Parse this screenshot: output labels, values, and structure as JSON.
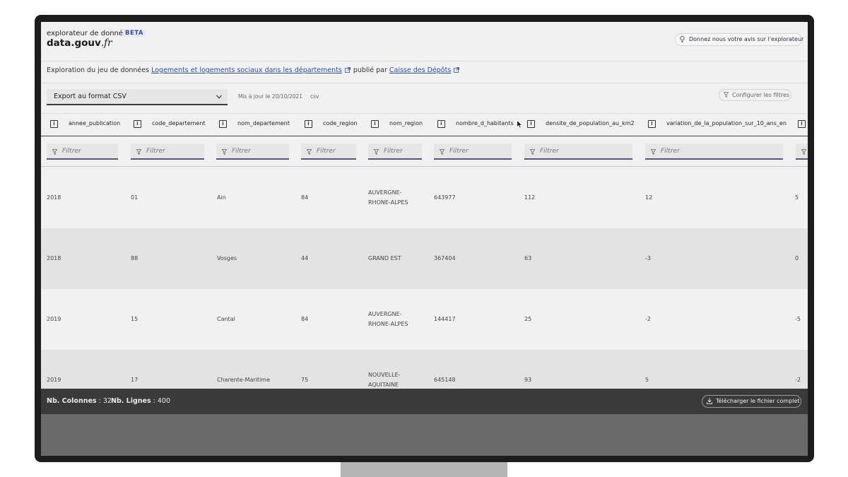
{
  "header": {
    "app_title": "explorateur de données",
    "beta_badge": "BETA",
    "brand": "data.gouv",
    "brand_suffix": ".fr",
    "feedback_label": "Donnez nous votre avis sur l'explorateur"
  },
  "dataset": {
    "prefix": "Exploration du jeu de données",
    "dataset_link": "Logements et logements sociaux dans les départements",
    "published_by": "publié par",
    "publisher_link": "Caisse des Dépôts"
  },
  "toolbar": {
    "export_value": "Export au format CSV",
    "updated": "Mis à jour le 20/10/2021",
    "format": "csv",
    "config_filters": "Configurer les filtres"
  },
  "columns": [
    {
      "name": "annee_publication",
      "filter_placeholder": "Filtrer"
    },
    {
      "name": "code_departement",
      "filter_placeholder": "Filtrer"
    },
    {
      "name": "nom_departement",
      "filter_placeholder": "Filtrer"
    },
    {
      "name": "code_region",
      "filter_placeholder": "Filtrer"
    },
    {
      "name": "nom_region",
      "filter_placeholder": "Filtrer"
    },
    {
      "name": "nombre_d_habitants",
      "filter_placeholder": "Filtrer"
    },
    {
      "name": "densite_de_population_au_km2",
      "filter_placeholder": "Filtrer"
    },
    {
      "name": "variation_de_la_population_sur_10_ans_en",
      "filter_placeholder": "Filtrer"
    },
    {
      "name": "",
      "filter_placeholder": ""
    }
  ],
  "rows": [
    [
      "2018",
      "01",
      "Ain",
      "84",
      "AUVERGNE-RHONE-ALPES",
      "643977",
      "112",
      "12",
      "5"
    ],
    [
      "2018",
      "88",
      "Vosges",
      "44",
      "GRAND EST",
      "367404",
      "63",
      "-3",
      "0"
    ],
    [
      "2019",
      "15",
      "Cantal",
      "84",
      "AUVERGNE-RHONE-ALPES",
      "144417",
      "25",
      "-2",
      "-5"
    ],
    [
      "2019",
      "17",
      "Charente-Maritime",
      "75",
      "NOUVELLE-AQUITAINE",
      "645148",
      "93",
      "5",
      "-2"
    ]
  ],
  "footer": {
    "columns_label": "Nb. Colonnes",
    "columns_value": ": 32",
    "rows_label": "Nb. Lignes",
    "rows_value": ": 400",
    "download_label": "Télécharger le fichier complet"
  },
  "colors": {
    "accent": "#2e4fa8",
    "footer_bg": "#3a3a3a",
    "row_alt": "#e3e3e3"
  }
}
